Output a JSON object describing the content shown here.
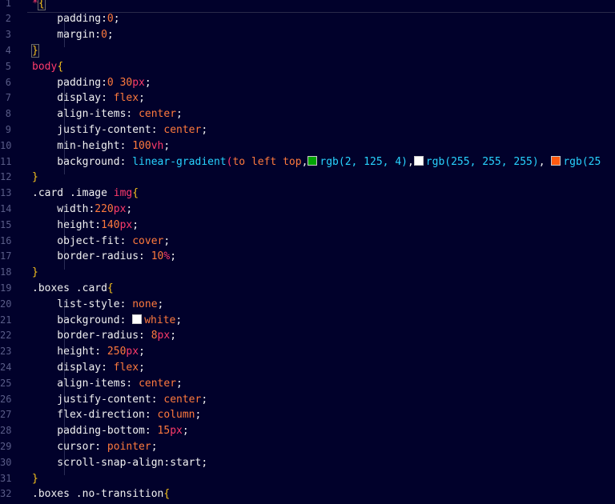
{
  "editor": {
    "line_numbers": [
      "1",
      "2",
      "3",
      "4",
      "5",
      "6",
      "7",
      "8",
      "9",
      "10",
      "11",
      "12",
      "13",
      "14",
      "15",
      "16",
      "17",
      "18",
      "19",
      "20",
      "21",
      "22",
      "23",
      "24",
      "25",
      "26",
      "27",
      "28",
      "29",
      "30",
      "31",
      "32"
    ],
    "lines": [
      [
        {
          "t": "*",
          "c": "t-sel"
        },
        {
          "t": "{",
          "c": "t-brace-hl"
        }
      ],
      [
        {
          "t": "    padding:",
          "c": "t-prop"
        },
        {
          "t": "0",
          "c": "t-num"
        },
        {
          "t": ";",
          "c": "t-plain"
        }
      ],
      [
        {
          "t": "    margin:",
          "c": "t-prop"
        },
        {
          "t": "0",
          "c": "t-num"
        },
        {
          "t": ";",
          "c": "t-plain"
        }
      ],
      [
        {
          "t": "}",
          "c": "t-brace-hl"
        }
      ],
      [
        {
          "t": "body",
          "c": "t-sel"
        },
        {
          "t": "{",
          "c": "t-brace"
        }
      ],
      [
        {
          "t": "    padding:",
          "c": "t-prop"
        },
        {
          "t": "0 30",
          "c": "t-num"
        },
        {
          "t": "px",
          "c": "t-unit"
        },
        {
          "t": ";",
          "c": "t-plain"
        }
      ],
      [
        {
          "t": "    display: ",
          "c": "t-prop"
        },
        {
          "t": "flex",
          "c": "t-val"
        },
        {
          "t": ";",
          "c": "t-plain"
        }
      ],
      [
        {
          "t": "    align-items: ",
          "c": "t-prop"
        },
        {
          "t": "center",
          "c": "t-val"
        },
        {
          "t": ";",
          "c": "t-plain"
        }
      ],
      [
        {
          "t": "    justify-content: ",
          "c": "t-prop"
        },
        {
          "t": "center",
          "c": "t-val"
        },
        {
          "t": ";",
          "c": "t-plain"
        }
      ],
      [
        {
          "t": "    min-height: ",
          "c": "t-prop"
        },
        {
          "t": "100",
          "c": "t-num"
        },
        {
          "t": "vh",
          "c": "t-unit"
        },
        {
          "t": ";",
          "c": "t-plain"
        }
      ],
      [
        {
          "t": "    background: ",
          "c": "t-prop"
        },
        {
          "t": "linear-gradient",
          "c": "t-fn"
        },
        {
          "t": "(",
          "c": "t-kw"
        },
        {
          "t": "to left top",
          "c": "t-val"
        },
        {
          "t": ",",
          "c": "t-plain"
        },
        {
          "sw": "#02a504"
        },
        {
          "t": "rgb",
          "c": "t-fn"
        },
        {
          "t": "(2, 125, 4)",
          "c": "t-fn"
        },
        {
          "t": ",",
          "c": "t-plain"
        },
        {
          "sw": "#ffffff"
        },
        {
          "t": "rgb",
          "c": "t-fn"
        },
        {
          "t": "(255, 255, 255)",
          "c": "t-fn"
        },
        {
          "t": ", ",
          "c": "t-plain"
        },
        {
          "sw": "#ff5a10"
        },
        {
          "t": "rgb",
          "c": "t-fn"
        },
        {
          "t": "(25",
          "c": "t-fn"
        }
      ],
      [
        {
          "t": "}",
          "c": "t-brace"
        }
      ],
      [
        {
          "t": ".card .image ",
          "c": "t-plain"
        },
        {
          "t": "img",
          "c": "t-tag"
        },
        {
          "t": "{",
          "c": "t-brace"
        }
      ],
      [
        {
          "t": "    width:",
          "c": "t-prop"
        },
        {
          "t": "220",
          "c": "t-num"
        },
        {
          "t": "px",
          "c": "t-unit"
        },
        {
          "t": ";",
          "c": "t-plain"
        }
      ],
      [
        {
          "t": "    height:",
          "c": "t-prop"
        },
        {
          "t": "140",
          "c": "t-num"
        },
        {
          "t": "px",
          "c": "t-unit"
        },
        {
          "t": ";",
          "c": "t-plain"
        }
      ],
      [
        {
          "t": "    object-fit: ",
          "c": "t-prop"
        },
        {
          "t": "cover",
          "c": "t-val"
        },
        {
          "t": ";",
          "c": "t-plain"
        }
      ],
      [
        {
          "t": "    border-radius: ",
          "c": "t-prop"
        },
        {
          "t": "10",
          "c": "t-num"
        },
        {
          "t": "%",
          "c": "t-unit"
        },
        {
          "t": ";",
          "c": "t-plain"
        }
      ],
      [
        {
          "t": "}",
          "c": "t-brace"
        }
      ],
      [
        {
          "t": ".boxes .card",
          "c": "t-plain"
        },
        {
          "t": "{",
          "c": "t-brace"
        }
      ],
      [
        {
          "t": "    list-style: ",
          "c": "t-prop"
        },
        {
          "t": "none",
          "c": "t-val"
        },
        {
          "t": ";",
          "c": "t-plain"
        }
      ],
      [
        {
          "t": "    background: ",
          "c": "t-prop"
        },
        {
          "sw": "#ffffff"
        },
        {
          "t": "white",
          "c": "t-val"
        },
        {
          "t": ";",
          "c": "t-plain"
        }
      ],
      [
        {
          "t": "    border-radius: ",
          "c": "t-prop"
        },
        {
          "t": "8",
          "c": "t-num"
        },
        {
          "t": "px",
          "c": "t-unit"
        },
        {
          "t": ";",
          "c": "t-plain"
        }
      ],
      [
        {
          "t": "    height: ",
          "c": "t-prop"
        },
        {
          "t": "250",
          "c": "t-num"
        },
        {
          "t": "px",
          "c": "t-unit"
        },
        {
          "t": ";",
          "c": "t-plain"
        }
      ],
      [
        {
          "t": "    display: ",
          "c": "t-prop"
        },
        {
          "t": "flex",
          "c": "t-val"
        },
        {
          "t": ";",
          "c": "t-plain"
        }
      ],
      [
        {
          "t": "    align-items: ",
          "c": "t-prop"
        },
        {
          "t": "center",
          "c": "t-val"
        },
        {
          "t": ";",
          "c": "t-plain"
        }
      ],
      [
        {
          "t": "    justify-content: ",
          "c": "t-prop"
        },
        {
          "t": "center",
          "c": "t-val"
        },
        {
          "t": ";",
          "c": "t-plain"
        }
      ],
      [
        {
          "t": "    flex-direction: ",
          "c": "t-prop"
        },
        {
          "t": "column",
          "c": "t-val"
        },
        {
          "t": ";",
          "c": "t-plain"
        }
      ],
      [
        {
          "t": "    padding-bottom: ",
          "c": "t-prop"
        },
        {
          "t": "15",
          "c": "t-num"
        },
        {
          "t": "px",
          "c": "t-unit"
        },
        {
          "t": ";",
          "c": "t-plain"
        }
      ],
      [
        {
          "t": "    cursor: ",
          "c": "t-prop"
        },
        {
          "t": "pointer",
          "c": "t-val"
        },
        {
          "t": ";",
          "c": "t-plain"
        }
      ],
      [
        {
          "t": "    scroll-snap-align:",
          "c": "t-prop"
        },
        {
          "t": "start",
          "c": "t-plain"
        },
        {
          "t": ";",
          "c": "t-plain"
        }
      ],
      [
        {
          "t": "}",
          "c": "t-brace"
        }
      ],
      [
        {
          "t": ".boxes .no-transition",
          "c": "t-plain"
        },
        {
          "t": "{",
          "c": "t-brace"
        }
      ]
    ]
  },
  "colors": {
    "background": "#01012b",
    "line_number": "#5a5d88",
    "selector": "#ff3b6b",
    "brace": "#f6c21c",
    "value": "#ff7a3d",
    "function": "#28d3ff"
  }
}
